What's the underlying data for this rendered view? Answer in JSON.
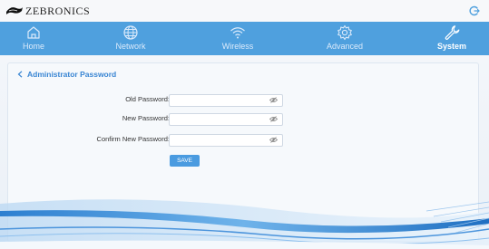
{
  "brand": {
    "name": "ZEBRONICS"
  },
  "nav": {
    "items": [
      {
        "label": "Home",
        "icon": "home-icon",
        "active": false
      },
      {
        "label": "Network",
        "icon": "globe-icon",
        "active": false
      },
      {
        "label": "Wireless",
        "icon": "wifi-icon",
        "active": false
      },
      {
        "label": "Advanced",
        "icon": "gear-icon",
        "active": false
      },
      {
        "label": "System",
        "icon": "wrench-icon",
        "active": true
      }
    ]
  },
  "page": {
    "title": "Administrator Password"
  },
  "form": {
    "old_password": {
      "label": "Old Password:",
      "value": ""
    },
    "new_password": {
      "label": "New Password:",
      "value": ""
    },
    "confirm_password": {
      "label": "Confirm New Password:",
      "value": ""
    },
    "save_label": "SAVE"
  },
  "colors": {
    "nav_bg": "#4fa0de",
    "accent": "#3a86d3",
    "button": "#4a9be0"
  }
}
